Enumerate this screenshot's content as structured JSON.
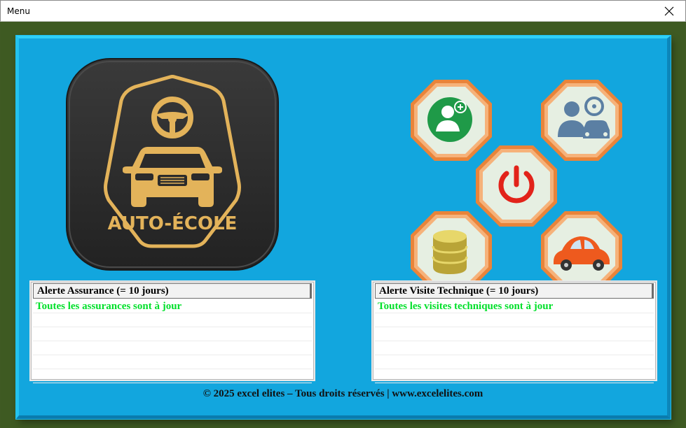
{
  "window": {
    "title": "Menu",
    "close_icon": "close-icon"
  },
  "logo": {
    "text": "AUTO-ÉCOLE",
    "background": "#2b2b2b",
    "accent": "#e3b35a"
  },
  "buttons": [
    {
      "name": "add-student-button",
      "icon": "add-user-icon"
    },
    {
      "name": "instructor-button",
      "icon": "instructor-icon"
    },
    {
      "name": "power-button",
      "icon": "power-icon"
    },
    {
      "name": "database-button",
      "icon": "database-icon"
    },
    {
      "name": "vehicle-button",
      "icon": "car-icon"
    }
  ],
  "alerts": {
    "insurance": {
      "header": "Alerte Assurance (= 10 jours)",
      "rows": [
        "Toutes les assurances sont à jour",
        "",
        "",
        "",
        "",
        ""
      ]
    },
    "inspection": {
      "header": "Alerte Visite Technique (= 10 jours)",
      "rows": [
        "Toutes les visites techniques sont à jour",
        "",
        "",
        "",
        "",
        ""
      ]
    }
  },
  "footer": {
    "text": "© 2025 excel elites – Tous droits réservés | www.excelelites.com"
  },
  "colors": {
    "panel": "#12a6de",
    "panel_border": "#2fd0f7",
    "octagon_border": "#e9843a",
    "octagon_fill": "#e6efe2",
    "ok_text": "#00e02a"
  }
}
